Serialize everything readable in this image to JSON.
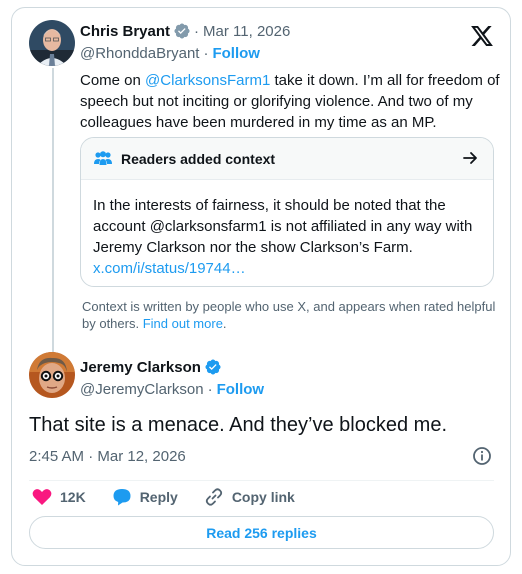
{
  "quoted_post": {
    "author_name": "Chris Bryant",
    "date": "Mar 11, 2026",
    "handle": "@RhonddaBryant",
    "separator": "·",
    "follow_label": "Follow",
    "text_mention": "@ClarksonsFarm1",
    "text_prefix": "Come on ",
    "text_rest": " take it down. I’m all for freedom of speech but not inciting or glorifying violence. And two of my colleagues have been murdered in my time as an MP."
  },
  "community_note": {
    "title": "Readers added context",
    "body": "In the interests of fairness, it should be noted that the account @clarksonsfarm1 is not affiliated in any way with Jeremy Clarkson nor the show Clarkson’s Farm.",
    "link": "x.com/i/status/19744…",
    "footer": "Context is written by people who use X, and appears when rated helpful by others.",
    "footer_link": "Find out more",
    "footer_end": "."
  },
  "main_post": {
    "author_name": "Jeremy Clarkson",
    "handle": "@JeremyClarkson",
    "separator": "·",
    "follow_label": "Follow",
    "text": "That site is a menace. And they’ve blocked me.",
    "timestamp": "2:45 AM · Mar 12, 2026"
  },
  "actions": {
    "likes": "12K",
    "reply_label": "Reply",
    "copy_label": "Copy link"
  },
  "read_replies_label": "Read 256 replies",
  "colors": {
    "accent": "#1d9bf0",
    "like": "#f91880",
    "muted": "#536471"
  }
}
